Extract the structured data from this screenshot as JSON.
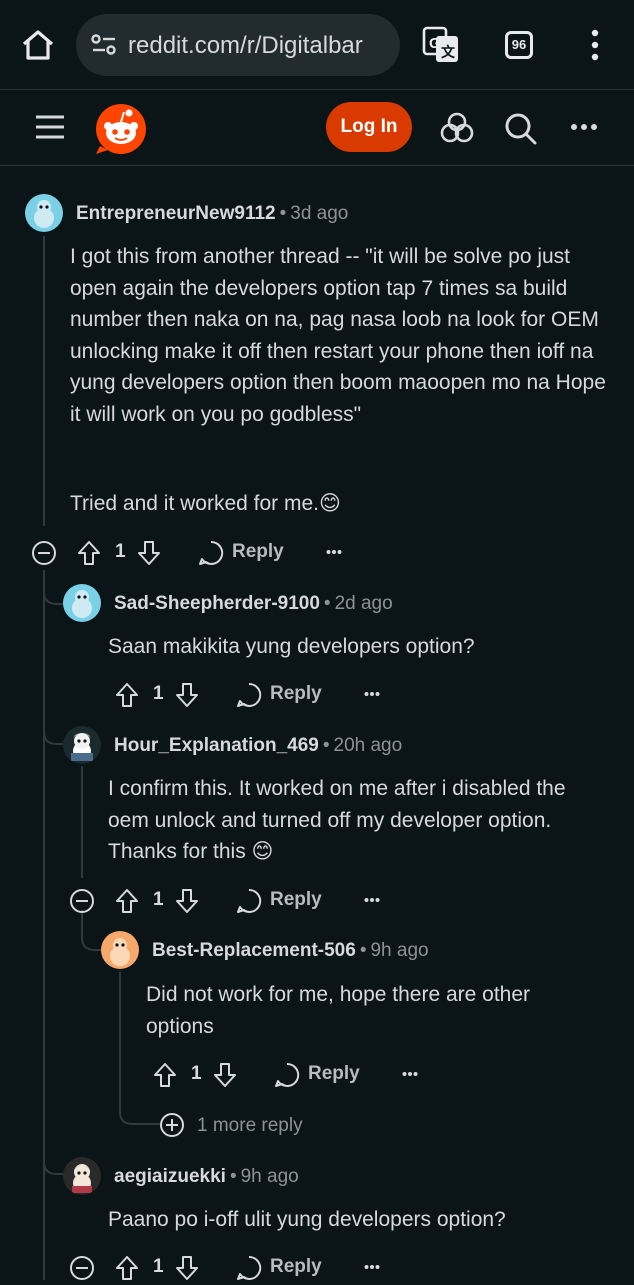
{
  "browser": {
    "url": "reddit.com/r/Digitalbar",
    "tab_count": "96"
  },
  "header": {
    "login_label": "Log In"
  },
  "comments": [
    {
      "username": "EntrepreneurNew9112",
      "age": "3d ago",
      "paragraphs": [
        "I got this from another thread -- \"it will be solve po just open again the developers option tap 7 times sa build number then naka on na, pag nasa loob na look for OEM unlocking make it off then restart your phone then ioff na yung developers option then boom maoopen mo na Hope it will work on you po godbless\"",
        "Tried and it worked for me.😊"
      ],
      "votes": "1",
      "reply_label": "Reply"
    },
    {
      "username": "Sad-Sheepherder-9100",
      "age": "2d ago",
      "text": "Saan makikita yung developers option?",
      "votes": "1",
      "reply_label": "Reply"
    },
    {
      "username": "Hour_Explanation_469",
      "age": "20h ago",
      "text": "I confirm this. It worked on me after i disabled the oem unlock and turned off my developer option. Thanks for this 😊",
      "votes": "1",
      "reply_label": "Reply"
    },
    {
      "username": "Best-Replacement-506",
      "age": "9h ago",
      "text": "Did not work for me, hope there are other options",
      "votes": "1",
      "reply_label": "Reply"
    },
    {
      "username": "aegiaizuekki",
      "age": "9h ago",
      "text": "Paano po i-off ulit yung developers option?",
      "votes": "1",
      "reply_label": "Reply"
    }
  ],
  "more_replies_label": "1 more reply",
  "icons": {
    "browser": [
      "home-icon",
      "site-settings-icon",
      "translate-icon",
      "tabs-icon",
      "browser-menu-icon"
    ],
    "header": [
      "hamburger-menu-icon",
      "reddit-logo-icon",
      "chat-icon",
      "search-icon",
      "more-options-icon"
    ],
    "comment": [
      "collapse-icon",
      "upvote-icon",
      "downvote-icon",
      "reply-icon",
      "more-actions-icon",
      "expand-icon"
    ]
  },
  "colors": {
    "background": "#0b1416",
    "accent": "#d93a00",
    "text": "#d7dadc",
    "muted": "#8b9396"
  }
}
